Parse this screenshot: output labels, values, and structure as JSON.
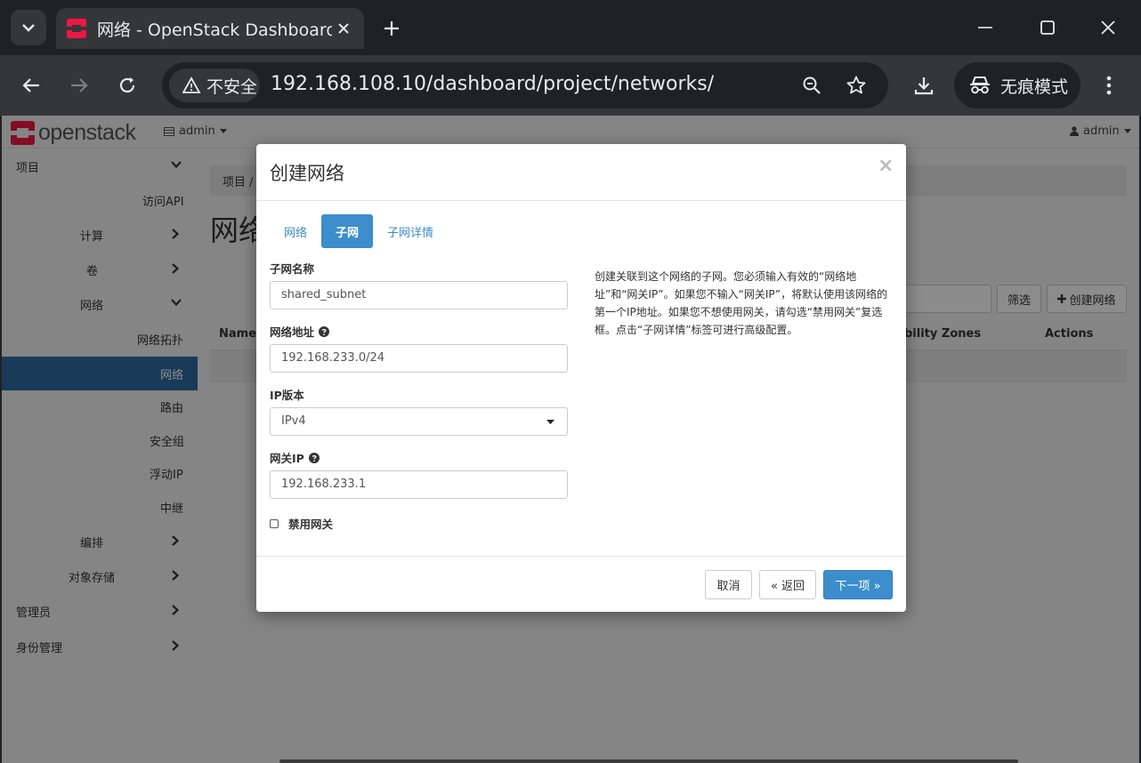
{
  "browser": {
    "tab_title": "网络 - OpenStack Dashboard",
    "security_label": "不安全",
    "url": "192.168.108.10/dashboard/project/networks/",
    "incognito_label": "无痕模式"
  },
  "header": {
    "logo_text": "openstack",
    "project_label": "admin",
    "user_label": "admin"
  },
  "sidebar": {
    "items": [
      {
        "label": "项目"
      },
      {
        "label": "访问API"
      },
      {
        "label": "计算"
      },
      {
        "label": "卷"
      },
      {
        "label": "网络"
      },
      {
        "label": "网络拓扑"
      },
      {
        "label": "网络"
      },
      {
        "label": "路由"
      },
      {
        "label": "安全组"
      },
      {
        "label": "浮动IP"
      },
      {
        "label": "中继"
      },
      {
        "label": "编排"
      },
      {
        "label": "对象存储"
      },
      {
        "label": "管理员"
      },
      {
        "label": "身份管理"
      }
    ]
  },
  "content": {
    "breadcrumb": "项目 /",
    "page_title": "网络",
    "filter_button": "筛选",
    "create_button": "创建网络",
    "columns": [
      "Name",
      "bility Zones",
      "Actions"
    ]
  },
  "modal": {
    "title": "创建网络",
    "close": "×",
    "tabs": [
      "网络",
      "子网",
      "子网详情"
    ],
    "subnet_name_label": "子网名称",
    "subnet_name_value": "shared_subnet",
    "network_address_label": "网络地址",
    "network_address_value": "192.168.233.0/24",
    "ip_version_label": "IP版本",
    "ip_version_value": "IPv4",
    "gateway_label": "网关IP",
    "gateway_value": "192.168.233.1",
    "disable_gateway_label": "禁用网关",
    "disable_gateway_checked": false,
    "help_text": "创建关联到这个网络的子网。您必须输入有效的“网络地址”和“网关IP”。如果您不输入“网关IP”，将默认使用该网络的第一个IP地址。如果您不想使用网关，请勾选“禁用网关”复选框。点击“子网详情”标签可进行高级配置。",
    "cancel_button": "取消",
    "back_button": "« 返回",
    "next_button": "下一项 »"
  }
}
